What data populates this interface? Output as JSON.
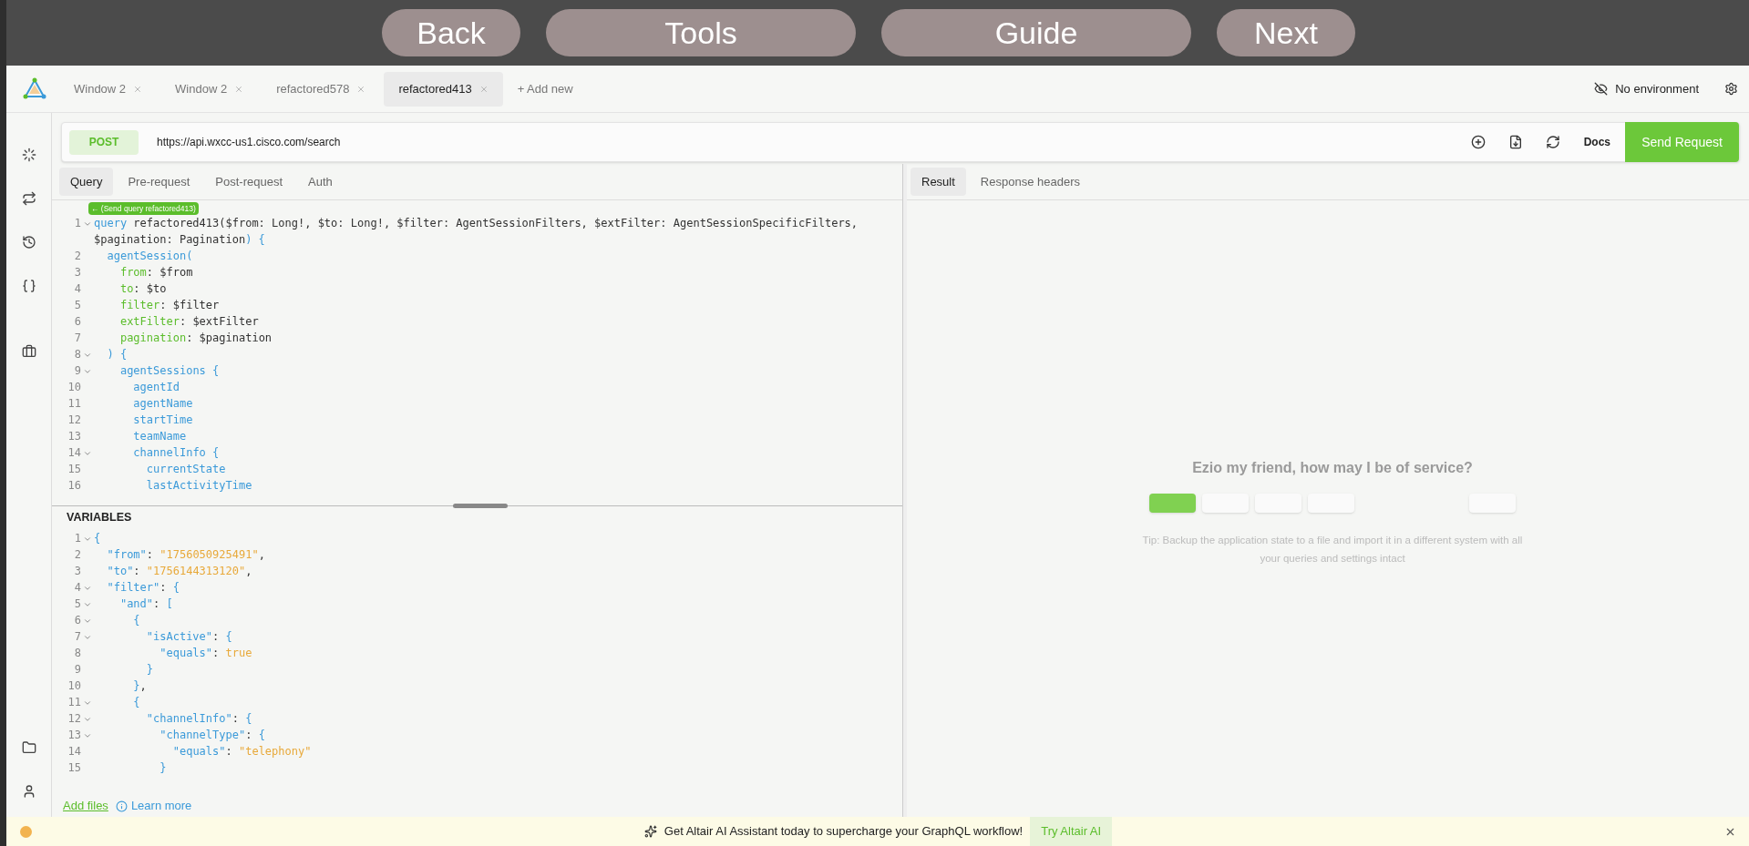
{
  "nav_buttons": [
    "Back",
    "Tools",
    "Guide",
    "Next"
  ],
  "window_tabs": [
    {
      "label": "Window 2",
      "selected": false
    },
    {
      "label": "Window 2",
      "selected": false
    },
    {
      "label": "refactored578",
      "selected": false
    },
    {
      "label": "refactored413",
      "selected": true
    }
  ],
  "add_tab": "+ Add new",
  "environment": "No environment",
  "request": {
    "method": "POST",
    "url": "https://api.wxcc-us1.cisco.com/search",
    "docs": "Docs",
    "send": "Send Request"
  },
  "query_tabs": [
    {
      "label": "Query",
      "selected": true
    },
    {
      "label": "Pre-request",
      "selected": false
    },
    {
      "label": "Post-request",
      "selected": false
    },
    {
      "label": "Auth",
      "selected": false
    }
  ],
  "result_tabs": [
    {
      "label": "Result",
      "selected": true
    },
    {
      "label": "Response headers",
      "selected": false
    }
  ],
  "send_hint": "← (Send query refactored413)",
  "query_lines": [
    {
      "number": "1",
      "foldable": true,
      "tokens": [
        {
          "kind": "keyword",
          "text": "query"
        },
        {
          "kind": "plain",
          "text": " refactored413($from: Long!, $to: Long!, $filter: AgentSessionFilters, $extFilter: AgentSessionSpecificFilters, $pagination: Pagination"
        },
        {
          "kind": "keyword",
          "text": ") {"
        }
      ]
    },
    {
      "number": "2",
      "foldable": false,
      "tokens": [
        {
          "kind": "keyword",
          "text": "  agentSession("
        }
      ]
    },
    {
      "number": "3",
      "foldable": false,
      "tokens": [
        {
          "kind": "arg",
          "text": "    from"
        },
        {
          "kind": "plain",
          "text": ": $from"
        }
      ]
    },
    {
      "number": "4",
      "foldable": false,
      "tokens": [
        {
          "kind": "arg",
          "text": "    to"
        },
        {
          "kind": "plain",
          "text": ": $to"
        }
      ]
    },
    {
      "number": "5",
      "foldable": false,
      "tokens": [
        {
          "kind": "arg",
          "text": "    filter"
        },
        {
          "kind": "plain",
          "text": ": $filter"
        }
      ]
    },
    {
      "number": "6",
      "foldable": false,
      "tokens": [
        {
          "kind": "arg",
          "text": "    extFilter"
        },
        {
          "kind": "plain",
          "text": ": $extFilter"
        }
      ]
    },
    {
      "number": "7",
      "foldable": false,
      "tokens": [
        {
          "kind": "arg",
          "text": "    pagination"
        },
        {
          "kind": "plain",
          "text": ": $pagination"
        }
      ]
    },
    {
      "number": "8",
      "foldable": true,
      "tokens": [
        {
          "kind": "keyword",
          "text": "  ) {"
        }
      ]
    },
    {
      "number": "9",
      "foldable": true,
      "tokens": [
        {
          "kind": "keyword",
          "text": "    agentSessions {"
        }
      ]
    },
    {
      "number": "10",
      "foldable": false,
      "tokens": [
        {
          "kind": "keyword",
          "text": "      agentId"
        }
      ]
    },
    {
      "number": "11",
      "foldable": false,
      "tokens": [
        {
          "kind": "keyword",
          "text": "      agentName"
        }
      ]
    },
    {
      "number": "12",
      "foldable": false,
      "tokens": [
        {
          "kind": "keyword",
          "text": "      startTime"
        }
      ]
    },
    {
      "number": "13",
      "foldable": false,
      "tokens": [
        {
          "kind": "keyword",
          "text": "      teamName"
        }
      ]
    },
    {
      "number": "14",
      "foldable": true,
      "tokens": [
        {
          "kind": "keyword",
          "text": "      channelInfo {"
        }
      ]
    },
    {
      "number": "15",
      "foldable": false,
      "tokens": [
        {
          "kind": "keyword",
          "text": "        currentState"
        }
      ]
    },
    {
      "number": "16",
      "foldable": false,
      "tokens": [
        {
          "kind": "keyword",
          "text": "        lastActivityTime"
        }
      ]
    }
  ],
  "variables_title": "VARIABLES",
  "variable_lines": [
    {
      "number": "1",
      "foldable": true,
      "tokens": [
        {
          "kind": "keyword",
          "text": "{"
        }
      ]
    },
    {
      "number": "2",
      "foldable": false,
      "tokens": [
        {
          "kind": "keyword",
          "text": "  \"from\""
        },
        {
          "kind": "plain",
          "text": ": "
        },
        {
          "kind": "string",
          "text": "\"1756050925491\""
        },
        {
          "kind": "plain",
          "text": ","
        }
      ]
    },
    {
      "number": "3",
      "foldable": false,
      "tokens": [
        {
          "kind": "keyword",
          "text": "  \"to\""
        },
        {
          "kind": "plain",
          "text": ": "
        },
        {
          "kind": "string",
          "text": "\"1756144313120\""
        },
        {
          "kind": "plain",
          "text": ","
        }
      ]
    },
    {
      "number": "4",
      "foldable": true,
      "tokens": [
        {
          "kind": "keyword",
          "text": "  \"filter\""
        },
        {
          "kind": "plain",
          "text": ": "
        },
        {
          "kind": "keyword",
          "text": "{"
        }
      ]
    },
    {
      "number": "5",
      "foldable": true,
      "tokens": [
        {
          "kind": "keyword",
          "text": "    \"and\""
        },
        {
          "kind": "plain",
          "text": ": "
        },
        {
          "kind": "keyword",
          "text": "["
        }
      ]
    },
    {
      "number": "6",
      "foldable": true,
      "tokens": [
        {
          "kind": "keyword",
          "text": "      {"
        }
      ]
    },
    {
      "number": "7",
      "foldable": true,
      "tokens": [
        {
          "kind": "keyword",
          "text": "        \"isActive\""
        },
        {
          "kind": "plain",
          "text": ": "
        },
        {
          "kind": "keyword",
          "text": "{"
        }
      ]
    },
    {
      "number": "8",
      "foldable": false,
      "tokens": [
        {
          "kind": "keyword",
          "text": "          \"equals\""
        },
        {
          "kind": "plain",
          "text": ": "
        },
        {
          "kind": "string",
          "text": "true"
        }
      ]
    },
    {
      "number": "9",
      "foldable": false,
      "tokens": [
        {
          "kind": "keyword",
          "text": "        }"
        }
      ]
    },
    {
      "number": "10",
      "foldable": false,
      "tokens": [
        {
          "kind": "keyword",
          "text": "      }"
        },
        {
          "kind": "plain",
          "text": ","
        }
      ]
    },
    {
      "number": "11",
      "foldable": true,
      "tokens": [
        {
          "kind": "keyword",
          "text": "      {"
        }
      ]
    },
    {
      "number": "12",
      "foldable": true,
      "tokens": [
        {
          "kind": "keyword",
          "text": "        \"channelInfo\""
        },
        {
          "kind": "plain",
          "text": ": "
        },
        {
          "kind": "keyword",
          "text": "{"
        }
      ]
    },
    {
      "number": "13",
      "foldable": true,
      "tokens": [
        {
          "kind": "keyword",
          "text": "          \"channelType\""
        },
        {
          "kind": "plain",
          "text": ": "
        },
        {
          "kind": "keyword",
          "text": "{"
        }
      ]
    },
    {
      "number": "14",
      "foldable": false,
      "tokens": [
        {
          "kind": "keyword",
          "text": "            \"equals\""
        },
        {
          "kind": "plain",
          "text": ": "
        },
        {
          "kind": "string",
          "text": "\"telephony\""
        }
      ]
    },
    {
      "number": "15",
      "foldable": false,
      "tokens": [
        {
          "kind": "keyword",
          "text": "          }"
        }
      ]
    }
  ],
  "add_files": "Add files",
  "learn_more": "Learn more",
  "welcome": {
    "title": "Ezio my friend, how may I be of service?",
    "quick_buttons": [
      {
        "selected": true
      },
      {
        "selected": false
      },
      {
        "selected": false
      },
      {
        "selected": false
      },
      {
        "selected": false
      }
    ],
    "tip": "Tip: Backup the application state to a file and import it in a different system with all your queries and settings intact"
  },
  "banner": {
    "text": "Get Altair AI Assistant today to supercharge your GraphQL workflow!",
    "button": "Try Altair AI"
  }
}
